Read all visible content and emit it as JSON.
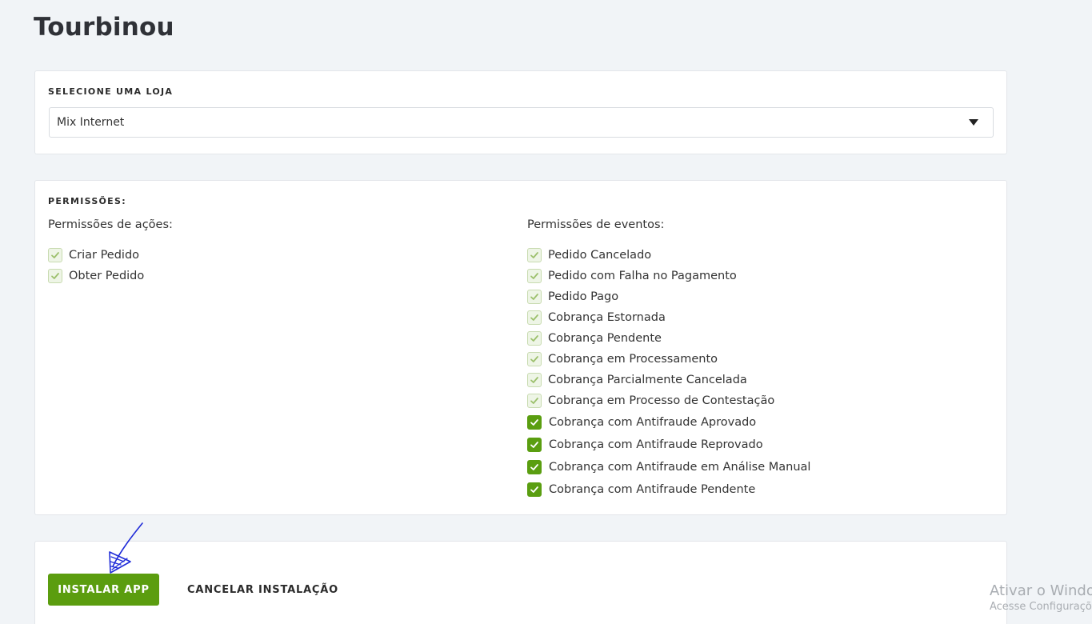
{
  "page": {
    "title": "Tourbinou"
  },
  "store": {
    "label": "SELECIONE UMA LOJA",
    "selected": "Mix Internet"
  },
  "permissions": {
    "label": "PERMISSÕES:",
    "actions_heading": "Permissões de ações:",
    "actions": [
      {
        "label": "Criar Pedido",
        "checked": true,
        "disabled": true
      },
      {
        "label": "Obter Pedido",
        "checked": true,
        "disabled": true
      }
    ],
    "events_heading": "Permissões de eventos:",
    "events": [
      {
        "label": "Pedido Cancelado",
        "checked": true,
        "disabled": true
      },
      {
        "label": "Pedido com Falha no Pagamento",
        "checked": true,
        "disabled": true
      },
      {
        "label": "Pedido Pago",
        "checked": true,
        "disabled": true
      },
      {
        "label": "Cobrança Estornada",
        "checked": true,
        "disabled": true
      },
      {
        "label": "Cobrança Pendente",
        "checked": true,
        "disabled": true
      },
      {
        "label": "Cobrança em Processamento",
        "checked": true,
        "disabled": true
      },
      {
        "label": "Cobrança Parcialmente Cancelada",
        "checked": true,
        "disabled": true
      },
      {
        "label": "Cobrança em Processo de Contestação",
        "checked": true,
        "disabled": true
      },
      {
        "label": "Cobrança com Antifraude Aprovado",
        "checked": true,
        "disabled": false
      },
      {
        "label": "Cobrança com Antifraude Reprovado",
        "checked": true,
        "disabled": false
      },
      {
        "label": "Cobrança com Antifraude em Análise Manual",
        "checked": true,
        "disabled": false
      },
      {
        "label": "Cobrança com Antifraude Pendente",
        "checked": true,
        "disabled": false
      }
    ]
  },
  "actions": {
    "install_label": "INSTALAR APP",
    "cancel_label": "CANCELAR INSTALAÇÃO"
  },
  "watermark": {
    "title": "Ativar o Windows",
    "subtitle": "Acesse Configurações para ativar o Windows."
  },
  "colors": {
    "accent": "#5b9d0f",
    "background": "#f1f4f7",
    "annotation": "#1f2bd8"
  }
}
